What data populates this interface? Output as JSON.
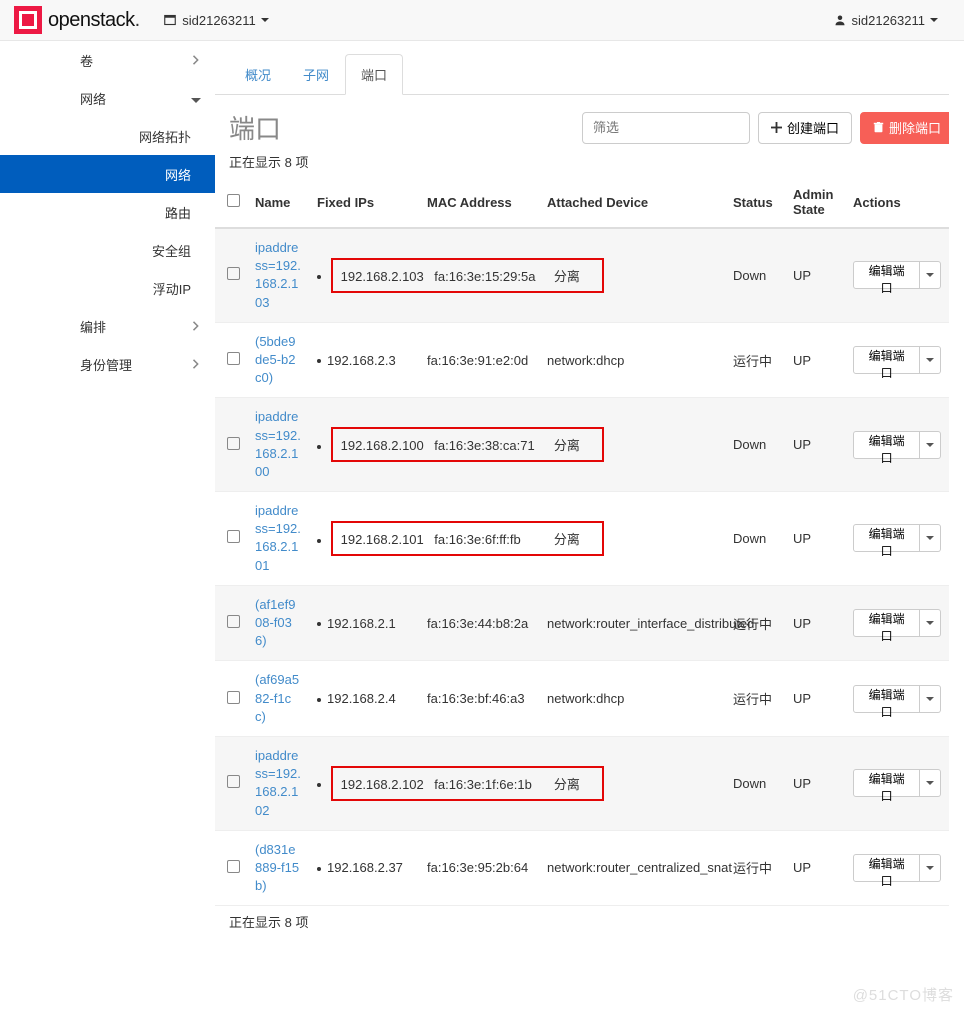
{
  "brand": "openstack",
  "project_switch": "sid21263211",
  "user_switch": "sid21263211",
  "sidebar": {
    "top_items": [
      {
        "label": "卷",
        "mode": "right"
      },
      {
        "label": "网络",
        "mode": "down"
      }
    ],
    "sub_items": [
      {
        "label": "网络拓扑",
        "active": false
      },
      {
        "label": "网络",
        "active": true
      },
      {
        "label": "路由",
        "active": false
      },
      {
        "label": "安全组",
        "active": false
      },
      {
        "label": "浮动IP",
        "active": false
      }
    ],
    "bottom_items": [
      {
        "label": "编排",
        "mode": "right"
      },
      {
        "label": "身份管理",
        "mode": "right"
      }
    ]
  },
  "tabs": [
    {
      "label": "概况",
      "active": false
    },
    {
      "label": "子网",
      "active": false
    },
    {
      "label": "端口",
      "active": true
    }
  ],
  "page_title": "端口",
  "filter_placeholder": "筛选",
  "create_button": "创建端口",
  "delete_button": "删除端口",
  "summary_top": "正在显示 8 项",
  "summary_bottom": "正在显示 8 项",
  "columns": {
    "name": "Name",
    "fixed_ips": "Fixed IPs",
    "mac": "MAC Address",
    "device": "Attached Device",
    "status": "Status",
    "admin": "Admin State",
    "actions": "Actions"
  },
  "action_label": "编辑端口",
  "rows": [
    {
      "name": "ipaddress=192.168.2.103",
      "ip": "192.168.2.103",
      "mac": "fa:16:3e:15:29:5a",
      "device": "分离",
      "status": "Down",
      "admin": "UP",
      "odd": true,
      "highlight": true
    },
    {
      "name": "(5bde9de5-b2c0)",
      "ip": "192.168.2.3",
      "mac": "fa:16:3e:91:e2:0d",
      "device": "network:dhcp",
      "status": "运行中",
      "admin": "UP",
      "odd": false,
      "highlight": false
    },
    {
      "name": "ipaddress=192.168.2.100",
      "ip": "192.168.2.100",
      "mac": "fa:16:3e:38:ca:71",
      "device": "分离",
      "status": "Down",
      "admin": "UP",
      "odd": true,
      "highlight": true
    },
    {
      "name": "ipaddress=192.168.2.101",
      "ip": "192.168.2.101",
      "mac": "fa:16:3e:6f:ff:fb",
      "device": "分离",
      "status": "Down",
      "admin": "UP",
      "odd": false,
      "highlight": true
    },
    {
      "name": "(af1ef908-f036)",
      "ip": "192.168.2.1",
      "mac": "fa:16:3e:44:b8:2a",
      "device": "network:router_interface_distributed",
      "status": "运行中",
      "admin": "UP",
      "odd": true,
      "highlight": false
    },
    {
      "name": "(af69a582-f1cc)",
      "ip": "192.168.2.4",
      "mac": "fa:16:3e:bf:46:a3",
      "device": "network:dhcp",
      "status": "运行中",
      "admin": "UP",
      "odd": false,
      "highlight": false
    },
    {
      "name": "ipaddress=192.168.2.102",
      "ip": "192.168.2.102",
      "mac": "fa:16:3e:1f:6e:1b",
      "device": "分离",
      "status": "Down",
      "admin": "UP",
      "odd": true,
      "highlight": true
    },
    {
      "name": "(d831e889-f15b)",
      "ip": "192.168.2.37",
      "mac": "fa:16:3e:95:2b:64",
      "device": "network:router_centralized_snat",
      "status": "运行中",
      "admin": "UP",
      "odd": false,
      "highlight": false
    }
  ],
  "watermark": "@51CTO博客"
}
